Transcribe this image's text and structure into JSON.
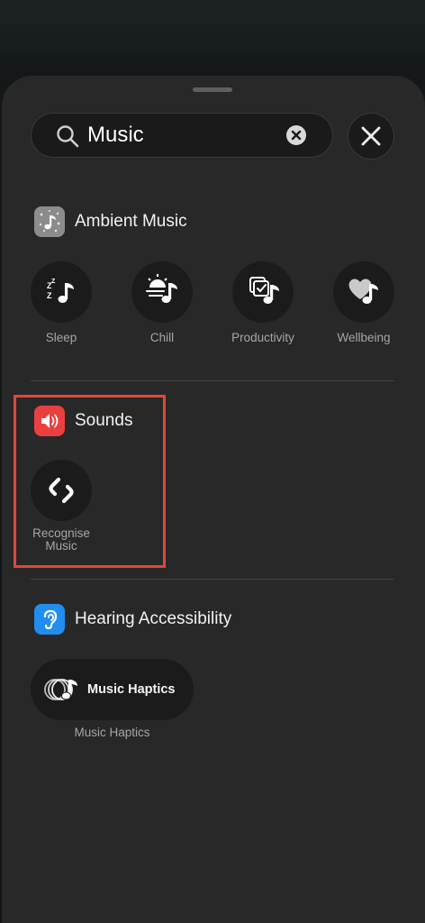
{
  "search": {
    "value": "Music",
    "icon": "magnifying-glass-icon",
    "clear_icon": "clear-x-icon"
  },
  "close_icon": "close-x-icon",
  "sections": {
    "ambient": {
      "title": "Ambient Music",
      "icon": "ambient-music-app-icon",
      "controls": [
        {
          "label": "Sleep",
          "icon": "sleep-music-icon"
        },
        {
          "label": "Chill",
          "icon": "chill-music-icon"
        },
        {
          "label": "Productivity",
          "icon": "productivity-music-icon"
        },
        {
          "label": "Wellbeing",
          "icon": "wellbeing-music-icon"
        }
      ]
    },
    "sounds": {
      "title": "Sounds",
      "icon": "speaker-app-icon",
      "controls": [
        {
          "label": "Recognise Music",
          "icon": "shazam-icon"
        }
      ]
    },
    "hearing": {
      "title": "Hearing Accessibility",
      "icon": "ear-app-icon",
      "controls": [
        {
          "label": "Music Haptics",
          "caption": "Music Haptics",
          "icon": "music-haptics-icon"
        }
      ]
    }
  },
  "colors": {
    "sheet": "#282828",
    "control_bg": "#1b1b1b",
    "highlight": "#e0463e",
    "sounds_icon": "#eb3f3f",
    "hearing_icon": "#1f8ef0"
  }
}
